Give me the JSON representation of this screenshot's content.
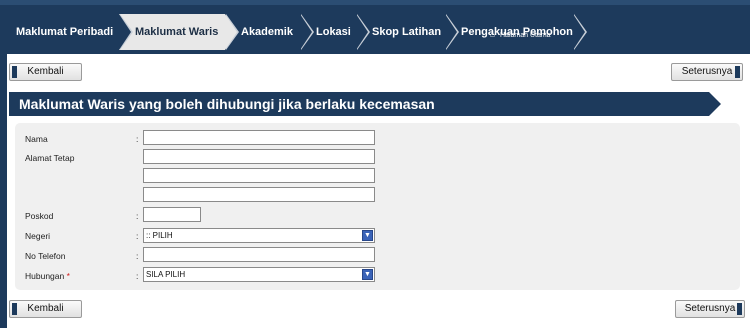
{
  "tabs": [
    {
      "label": "Maklumat Peribadi"
    },
    {
      "label": "Maklumat Waris"
    },
    {
      "label": "Akademik"
    },
    {
      "label": "Lokasi"
    },
    {
      "label": "Skop Latihan"
    },
    {
      "label": "Pengakuan Pemohon"
    }
  ],
  "home_link": {
    "label": "Halaman Utama",
    "icon": "home-icon"
  },
  "buttons": {
    "back": "Kembali",
    "next": "Seterusnya"
  },
  "section": {
    "title": "Maklumat Waris yang boleh dihubungi jika berlaku kecemasan"
  },
  "form": {
    "nama": {
      "label": "Nama",
      "value": ""
    },
    "alamat": {
      "label": "Alamat Tetap",
      "line1": "",
      "line2": "",
      "line3": ""
    },
    "poskod": {
      "label": "Poskod",
      "value": ""
    },
    "negeri": {
      "label": "Negeri",
      "selected": ":: PILIH"
    },
    "telefon": {
      "label": "No Telefon",
      "value": ""
    },
    "hubungan": {
      "label": "Hubungan",
      "required_mark": "*",
      "selected": "SILA PILIH"
    }
  },
  "colors": {
    "primary": "#1d3a5c",
    "active_tab": "#e8e8e8",
    "form_bg": "#f0f0f0",
    "required": "#d11a1a",
    "select_button": "#3a63b8"
  }
}
